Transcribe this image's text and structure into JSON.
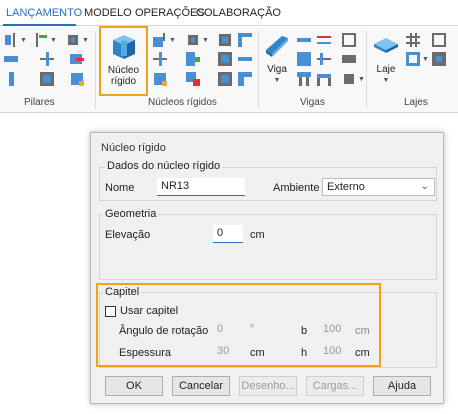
{
  "ribbon": {
    "tabs": [
      {
        "label": "LANÇAMENTO"
      },
      {
        "label": "MODELO"
      },
      {
        "label": "OPERAÇÕES"
      },
      {
        "label": "COLABORAÇÃO"
      }
    ],
    "groups": {
      "pilares": "Pilares",
      "nucleos": "Núcleos rígidos",
      "vigas": "Vigas",
      "lajes": "Lajes"
    },
    "big_buttons": {
      "nucleo_line1": "Núcleo",
      "nucleo_line2": "rígido",
      "viga": "Viga",
      "laje": "Laje"
    },
    "accent": "#2a6ebb",
    "highlight": "#f0a21a"
  },
  "dialog": {
    "title": "Núcleo rígido",
    "dados": {
      "title": "Dados do núcleo rígido",
      "nome_label": "Nome",
      "nome_value": "NR13",
      "ambiente_label": "Ambiente",
      "ambiente_value": "Externo"
    },
    "geometria": {
      "title": "Geometria",
      "elevacao_label": "Elevação",
      "elevacao_value": "0",
      "elevacao_unit": "cm"
    },
    "capitel": {
      "title": "Capitel",
      "usar_label": "Usar capitel",
      "usar_checked": false,
      "angulo_label": "Ângulo de rotação",
      "angulo_value": "0",
      "angulo_unit": "°",
      "b_label": "b",
      "b_value": "100",
      "b_unit": "cm",
      "espessura_label": "Espessura",
      "espessura_value": "30",
      "espessura_unit": "cm",
      "h_label": "h",
      "h_value": "100",
      "h_unit": "cm"
    },
    "buttons": {
      "ok": "OK",
      "cancelar": "Cancelar",
      "desenho": "Desenho...",
      "cargas": "Cargas...",
      "ajuda": "Ajuda"
    }
  }
}
